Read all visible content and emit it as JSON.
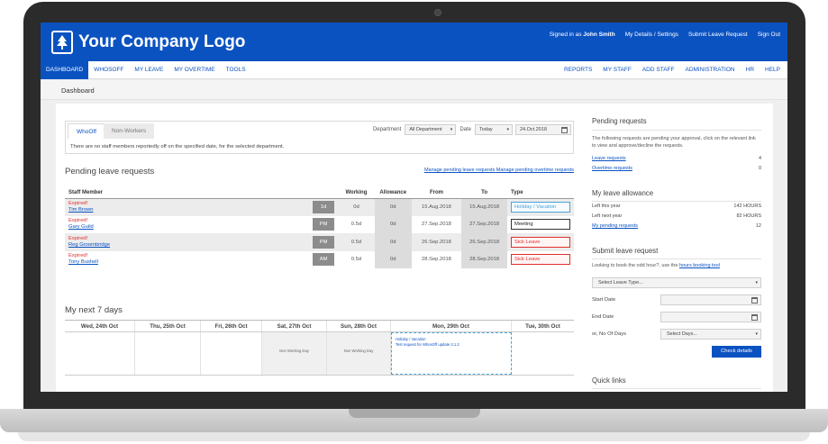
{
  "header": {
    "logo_text": "Your Company Logo",
    "signed_in_prefix": "Signed in as",
    "user_name": "John Smith",
    "links": [
      "My Details / Settings",
      "Submit Leave Request",
      "Sign Out"
    ]
  },
  "nav": {
    "left": [
      "DASHBOARD",
      "WHOSOFF",
      "MY LEAVE",
      "MY OVERTIME",
      "TOOLS"
    ],
    "right": [
      "REPORTS",
      "MY STAFF",
      "ADD STAFF",
      "ADMINISTRATION",
      "HR",
      "HELP"
    ]
  },
  "breadcrumb": "Dashboard",
  "whosoff": {
    "tabs": [
      "WhoOff",
      "Non-Workers"
    ],
    "department_label": "Department",
    "department_value": "All Department",
    "date_label": "Date",
    "date_select": "Today",
    "date_value": "24.Oct.2018",
    "message": "There are no staff members reportedly off on the specified date, for the selected department."
  },
  "pending": {
    "title": "Pending leave requests",
    "link1": "Manage pending leave requests",
    "link2": "Manage pending overtime requests",
    "columns": [
      "Staff Member",
      "",
      "Working",
      "Allowance",
      "From",
      "To",
      "Type"
    ],
    "rows": [
      {
        "status": "Expired!",
        "name": "Tim Brown",
        "badge": "1d",
        "working": "0d",
        "allowance": "0d",
        "from": "15.Aug.2018",
        "to": "15.Aug.2018",
        "type": "Holiday / Vacation"
      },
      {
        "status": "Expired!",
        "name": "Gary Guild",
        "badge": "PM",
        "working": "0.5d",
        "allowance": "0d",
        "from": "27.Sep.2018",
        "to": "27.Sep.2018",
        "type": "Meeting"
      },
      {
        "status": "Expired!",
        "name": "Reg Groombridge",
        "badge": "PM",
        "working": "0.5d",
        "allowance": "0d",
        "from": "26.Sep.2018",
        "to": "26.Sep.2018",
        "type": "Sick Leave"
      },
      {
        "status": "Expired!",
        "name": "Tony Bushell",
        "badge": "AM",
        "working": "0.5d",
        "allowance": "0d",
        "from": "28.Sep.2018",
        "to": "28.Sep.2018",
        "type": "Sick Leave"
      }
    ]
  },
  "week": {
    "title": "My next 7 days",
    "days": [
      "Wed, 24th Oct",
      "Thu, 25th Oct",
      "Fri, 26th Oct",
      "Sat, 27th Oct",
      "Sun, 28th Oct",
      "Mon, 29th Oct",
      "Tue, 30th Oct"
    ],
    "non_working": "Non Working Day",
    "holiday_type": "Holiday / Vacation",
    "holiday_note": "Test request for WhosOff update 2.1.2"
  },
  "sidebar": {
    "pending_title": "Pending requests",
    "pending_text": "The following requests are pending your approval, click on the relevant link to view and approve/decline the requests.",
    "leave_requests_label": "Leave requests",
    "leave_requests_count": "4",
    "overtime_requests_label": "Overtime requests",
    "overtime_requests_count": "0",
    "allowance_title": "My leave allowance",
    "left_this_year_label": "Left this year",
    "left_this_year_value": "142 HOURS",
    "left_next_year_label": "Left next year",
    "left_next_year_value": "82 HOURS",
    "my_pending_label": "My pending requests",
    "my_pending_value": "12",
    "submit_title": "Submit leave request",
    "submit_text_prefix": "Looking to book the odd hour?, use the",
    "submit_text_link": "hours booking tool",
    "leave_type_placeholder": "Select Leave Type...",
    "start_date_label": "Start Date",
    "end_date_label": "End Date",
    "no_of_days_label": "or, No Of Days",
    "select_days": "Select Days...",
    "check_button": "Check details",
    "quick_links_title": "Quick links"
  }
}
